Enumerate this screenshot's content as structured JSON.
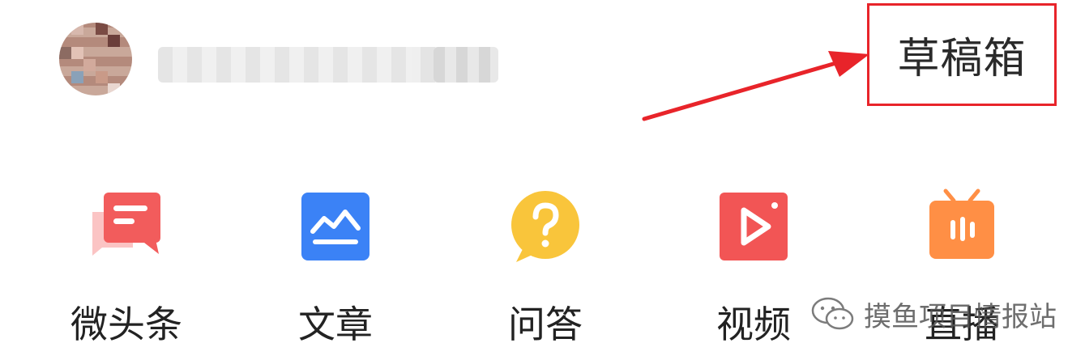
{
  "header": {
    "avatar_icon": "user-avatar",
    "drafts_label": "草稿箱"
  },
  "menu": {
    "items": [
      {
        "label": "微头条",
        "icon": "micro-headline-icon",
        "color": "#f25c5c"
      },
      {
        "label": "文章",
        "icon": "article-icon",
        "color": "#3b82f6"
      },
      {
        "label": "问答",
        "icon": "qa-icon",
        "color": "#f9c53b"
      },
      {
        "label": "视频",
        "icon": "video-icon",
        "color": "#f25555"
      },
      {
        "label": "直播",
        "icon": "live-icon",
        "color": "#ff8f45"
      }
    ]
  },
  "watermark": {
    "text": "摸鱼项目情报站",
    "icon": "wechat-icon"
  },
  "annotation": {
    "highlight_color": "#e8242a"
  }
}
